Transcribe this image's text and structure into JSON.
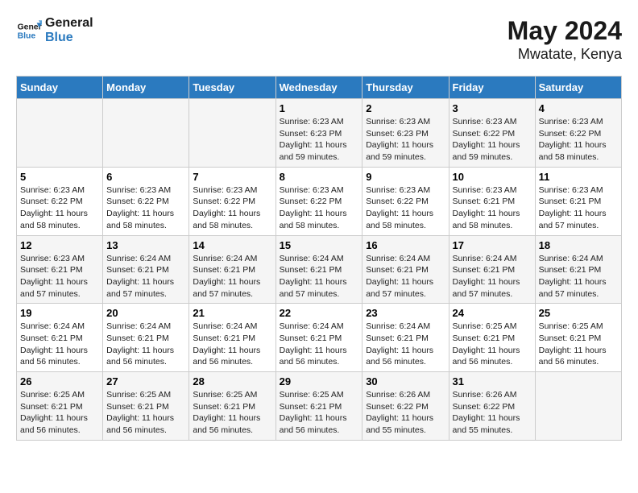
{
  "header": {
    "logo_line1": "General",
    "logo_line2": "Blue",
    "title": "May 2024",
    "subtitle": "Mwatate, Kenya"
  },
  "weekdays": [
    "Sunday",
    "Monday",
    "Tuesday",
    "Wednesday",
    "Thursday",
    "Friday",
    "Saturday"
  ],
  "weeks": [
    [
      {
        "day": "",
        "info": ""
      },
      {
        "day": "",
        "info": ""
      },
      {
        "day": "",
        "info": ""
      },
      {
        "day": "1",
        "info": "Sunrise: 6:23 AM\nSunset: 6:23 PM\nDaylight: 11 hours and 59 minutes."
      },
      {
        "day": "2",
        "info": "Sunrise: 6:23 AM\nSunset: 6:23 PM\nDaylight: 11 hours and 59 minutes."
      },
      {
        "day": "3",
        "info": "Sunrise: 6:23 AM\nSunset: 6:22 PM\nDaylight: 11 hours and 59 minutes."
      },
      {
        "day": "4",
        "info": "Sunrise: 6:23 AM\nSunset: 6:22 PM\nDaylight: 11 hours and 58 minutes."
      }
    ],
    [
      {
        "day": "5",
        "info": "Sunrise: 6:23 AM\nSunset: 6:22 PM\nDaylight: 11 hours and 58 minutes."
      },
      {
        "day": "6",
        "info": "Sunrise: 6:23 AM\nSunset: 6:22 PM\nDaylight: 11 hours and 58 minutes."
      },
      {
        "day": "7",
        "info": "Sunrise: 6:23 AM\nSunset: 6:22 PM\nDaylight: 11 hours and 58 minutes."
      },
      {
        "day": "8",
        "info": "Sunrise: 6:23 AM\nSunset: 6:22 PM\nDaylight: 11 hours and 58 minutes."
      },
      {
        "day": "9",
        "info": "Sunrise: 6:23 AM\nSunset: 6:22 PM\nDaylight: 11 hours and 58 minutes."
      },
      {
        "day": "10",
        "info": "Sunrise: 6:23 AM\nSunset: 6:21 PM\nDaylight: 11 hours and 58 minutes."
      },
      {
        "day": "11",
        "info": "Sunrise: 6:23 AM\nSunset: 6:21 PM\nDaylight: 11 hours and 57 minutes."
      }
    ],
    [
      {
        "day": "12",
        "info": "Sunrise: 6:23 AM\nSunset: 6:21 PM\nDaylight: 11 hours and 57 minutes."
      },
      {
        "day": "13",
        "info": "Sunrise: 6:24 AM\nSunset: 6:21 PM\nDaylight: 11 hours and 57 minutes."
      },
      {
        "day": "14",
        "info": "Sunrise: 6:24 AM\nSunset: 6:21 PM\nDaylight: 11 hours and 57 minutes."
      },
      {
        "day": "15",
        "info": "Sunrise: 6:24 AM\nSunset: 6:21 PM\nDaylight: 11 hours and 57 minutes."
      },
      {
        "day": "16",
        "info": "Sunrise: 6:24 AM\nSunset: 6:21 PM\nDaylight: 11 hours and 57 minutes."
      },
      {
        "day": "17",
        "info": "Sunrise: 6:24 AM\nSunset: 6:21 PM\nDaylight: 11 hours and 57 minutes."
      },
      {
        "day": "18",
        "info": "Sunrise: 6:24 AM\nSunset: 6:21 PM\nDaylight: 11 hours and 57 minutes."
      }
    ],
    [
      {
        "day": "19",
        "info": "Sunrise: 6:24 AM\nSunset: 6:21 PM\nDaylight: 11 hours and 56 minutes."
      },
      {
        "day": "20",
        "info": "Sunrise: 6:24 AM\nSunset: 6:21 PM\nDaylight: 11 hours and 56 minutes."
      },
      {
        "day": "21",
        "info": "Sunrise: 6:24 AM\nSunset: 6:21 PM\nDaylight: 11 hours and 56 minutes."
      },
      {
        "day": "22",
        "info": "Sunrise: 6:24 AM\nSunset: 6:21 PM\nDaylight: 11 hours and 56 minutes."
      },
      {
        "day": "23",
        "info": "Sunrise: 6:24 AM\nSunset: 6:21 PM\nDaylight: 11 hours and 56 minutes."
      },
      {
        "day": "24",
        "info": "Sunrise: 6:25 AM\nSunset: 6:21 PM\nDaylight: 11 hours and 56 minutes."
      },
      {
        "day": "25",
        "info": "Sunrise: 6:25 AM\nSunset: 6:21 PM\nDaylight: 11 hours and 56 minutes."
      }
    ],
    [
      {
        "day": "26",
        "info": "Sunrise: 6:25 AM\nSunset: 6:21 PM\nDaylight: 11 hours and 56 minutes."
      },
      {
        "day": "27",
        "info": "Sunrise: 6:25 AM\nSunset: 6:21 PM\nDaylight: 11 hours and 56 minutes."
      },
      {
        "day": "28",
        "info": "Sunrise: 6:25 AM\nSunset: 6:21 PM\nDaylight: 11 hours and 56 minutes."
      },
      {
        "day": "29",
        "info": "Sunrise: 6:25 AM\nSunset: 6:21 PM\nDaylight: 11 hours and 56 minutes."
      },
      {
        "day": "30",
        "info": "Sunrise: 6:26 AM\nSunset: 6:22 PM\nDaylight: 11 hours and 55 minutes."
      },
      {
        "day": "31",
        "info": "Sunrise: 6:26 AM\nSunset: 6:22 PM\nDaylight: 11 hours and 55 minutes."
      },
      {
        "day": "",
        "info": ""
      }
    ]
  ]
}
